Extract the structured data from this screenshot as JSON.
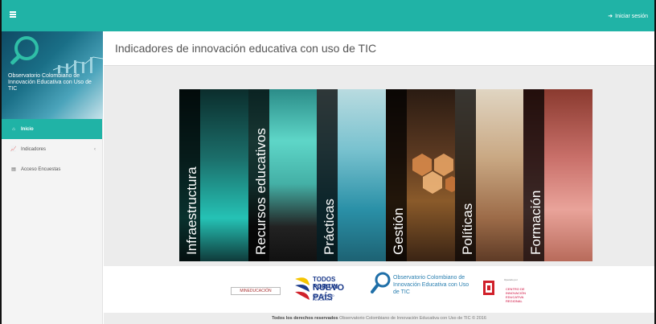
{
  "topbar": {
    "login_label": "Iniciar sesión",
    "accent": "#20b3a6"
  },
  "sidebar": {
    "brand_title": "Observatorio Colombiano de Innovación Educativa con Uso de TIC",
    "items": [
      {
        "label": "Inicio",
        "icon": "home-icon",
        "active": true
      },
      {
        "label": "Indicadores",
        "icon": "chart-icon",
        "active": false
      },
      {
        "label": "Acceso Encuestas",
        "icon": "document-icon",
        "active": false
      }
    ]
  },
  "main": {
    "title": "Indicadores de innovación educativa con uso de TIC",
    "panels": [
      {
        "label": "Infraestructura"
      },
      {
        "label": "Recursos educativos"
      },
      {
        "label": "Prácticas"
      },
      {
        "label": "Gestión"
      },
      {
        "label": "Políticas"
      },
      {
        "label": "Formación"
      }
    ]
  },
  "footer": {
    "logos": {
      "mineducacion": "MINEDUCACIÓN",
      "todos_a": "TODOS POR UN",
      "todos_b": "NUEVO PAÍS",
      "todos_c": "PAZ EQUIDAD EDUCACIÓN",
      "observatorio": "Observatorio Colombiano de Innovación Educativa con Uso de TIC",
      "ccc_tag": "Operado por",
      "ccc_label": "CENTRO DE INNOVACIÓN EDUCATIVA REGIONAL"
    },
    "copyright_bold": "Todos los derechos reservados",
    "copyright_rest": " Observatorio Colombiano de Innovación Educativa con Uso de TIC © 2016"
  }
}
